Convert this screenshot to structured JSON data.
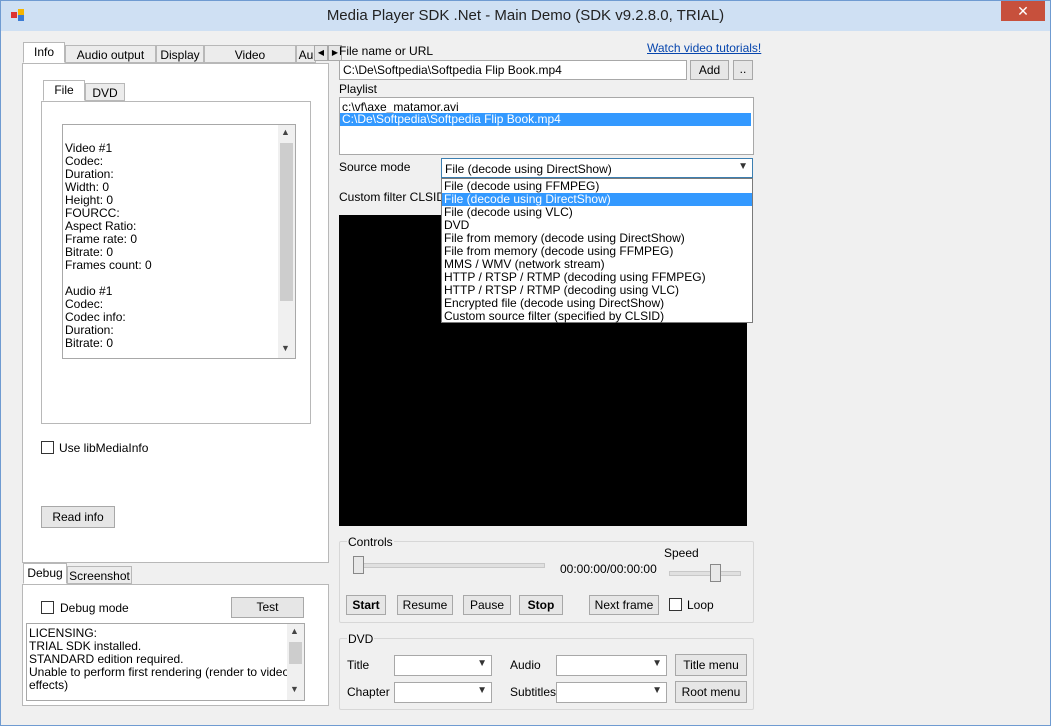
{
  "window": {
    "title": "Media Player SDK .Net - Main Demo (SDK v9.2.8.0, TRIAL)",
    "close_glyph": "✕"
  },
  "left": {
    "tabs": [
      "Info",
      "Audio output",
      "Display",
      "Video processing",
      "Au"
    ],
    "subtabs": [
      "File",
      "DVD"
    ],
    "info_lines": [
      "",
      "Video #1",
      "Codec:",
      "Duration:",
      "Width: 0",
      "Height: 0",
      "FOURCC:",
      "Aspect Ratio:",
      "Frame rate: 0",
      "Bitrate: 0",
      "Frames count: 0",
      "",
      "Audio #1",
      "Codec:",
      "Codec info:",
      "Duration:",
      "Bitrate: 0"
    ],
    "use_libmediainfo": "Use libMediaInfo",
    "read_info": "Read info",
    "bottom_tabs": [
      "Debug",
      "Screenshot"
    ],
    "debug_mode": "Debug mode",
    "test": "Test",
    "log_lines": [
      "LICENSING:",
      "TRIAL SDK installed.",
      "STANDARD edition required.",
      "Unable to perform first rendering (render to video",
      "effects)"
    ]
  },
  "right": {
    "file_label": "File name or URL",
    "tutorials_link": "Watch video tutorials!",
    "file_value": "C:\\De\\Softpedia\\Softpedia Flip Book.mp4",
    "add": "Add",
    "browse": "..",
    "playlist_label": "Playlist",
    "playlist": [
      "c:\\vf\\axe_matamor.avi",
      "C:\\De\\Softpedia\\Softpedia Flip Book.mp4"
    ],
    "source_mode_label": "Source mode",
    "source_mode_value": "File (decode using DirectShow)",
    "custom_filter_label": "Custom filter CLSID",
    "dropdown_options": [
      "File (decode using FFMPEG)",
      "File (decode using DirectShow)",
      "File (decode using VLC)",
      "DVD",
      "File from memory (decode using DirectShow)",
      "File from memory (decode using FFMPEG)",
      "MMS / WMV (network stream)",
      "HTTP / RTSP / RTMP (decoding using FFMPEG)",
      "HTTP / RTSP / RTMP (decoding using VLC)",
      "Encrypted file (decode using DirectShow)",
      "Custom source filter (specified by CLSID)"
    ],
    "controls_label": "Controls",
    "time": "00:00:00/00:00:00",
    "speed_label": "Speed",
    "start": "Start",
    "resume": "Resume",
    "pause": "Pause",
    "stop": "Stop",
    "next_frame": "Next frame",
    "loop": "Loop",
    "dvd_label": "DVD",
    "title_label": "Title",
    "chapter_label": "Chapter",
    "audio_label": "Audio",
    "subtitles_label": "Subtitles",
    "title_menu": "Title menu",
    "root_menu": "Root menu"
  }
}
